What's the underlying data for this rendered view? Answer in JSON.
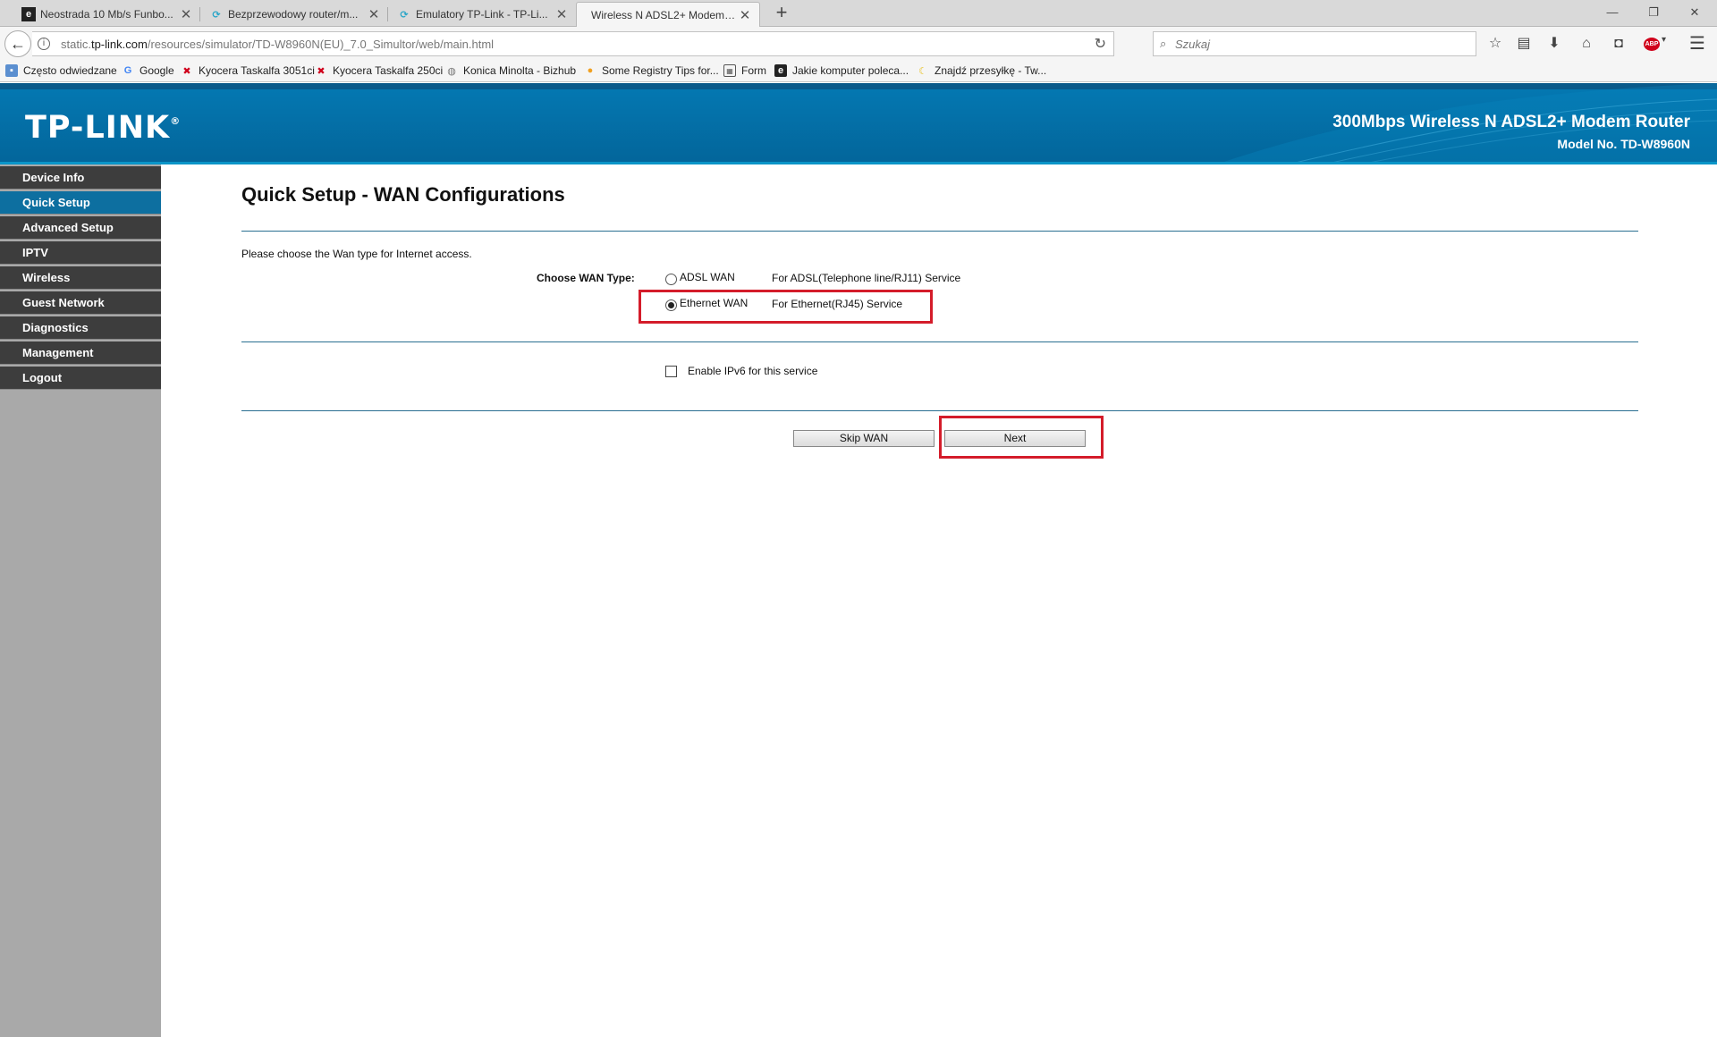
{
  "browser": {
    "tabs": [
      {
        "title": "Neostrada 10 Mb/s Funbo...",
        "icon": "site-favicon"
      },
      {
        "title": "Bezprzewodowy router/m...",
        "icon": "tplink-favicon"
      },
      {
        "title": "Emulatory TP-Link - TP-Li...",
        "icon": "tplink-favicon"
      },
      {
        "title": "Wireless N ADSL2+ Modem R...",
        "icon": "none"
      }
    ],
    "url_prefix": "static.",
    "url_domain": "tp-link.com",
    "url_path": "/resources/simulator/TD-W8960N(EU)_7.0_Simultor/web/main.html",
    "search_placeholder": "Szukaj",
    "bookmarks": [
      "Często odwiedzane",
      "Google",
      "Kyocera Taskalfa 3051ci",
      "Kyocera Taskalfa 250ci",
      "Konica Minolta - Bizhub",
      "Some Registry Tips for...",
      "Form",
      "Jakie komputer poleca...",
      "Znajdź przesyłkę - Tw..."
    ]
  },
  "header": {
    "logo": "TP-LINK",
    "logo_mark": "®",
    "product": "300Mbps Wireless N ADSL2+ Modem Router",
    "model": "Model No. TD-W8960N"
  },
  "sidebar": {
    "items": [
      {
        "label": "Device Info"
      },
      {
        "label": "Quick Setup",
        "active": true
      },
      {
        "label": "Advanced Setup"
      },
      {
        "label": "IPTV"
      },
      {
        "label": "Wireless"
      },
      {
        "label": "Guest Network"
      },
      {
        "label": "Diagnostics"
      },
      {
        "label": "Management"
      },
      {
        "label": "Logout"
      }
    ]
  },
  "main": {
    "title": "Quick Setup - WAN Configurations",
    "intro": "Please choose the Wan type for Internet access.",
    "wan_label": "Choose WAN Type:",
    "options": [
      {
        "label": "ADSL WAN",
        "desc": "For ADSL(Telephone line/RJ11) Service",
        "checked": false
      },
      {
        "label": "Ethernet WAN",
        "desc": "For Ethernet(RJ45) Service",
        "checked": true
      }
    ],
    "ipv6_label": "Enable IPv6 for this service",
    "ipv6_checked": false,
    "skip_button": "Skip WAN",
    "next_button": "Next"
  },
  "colors": {
    "header_blue": "#0479b3",
    "menu_dark": "#3d3d3d",
    "menu_active": "#0d6fa0",
    "highlight_red": "#d41c2a"
  }
}
